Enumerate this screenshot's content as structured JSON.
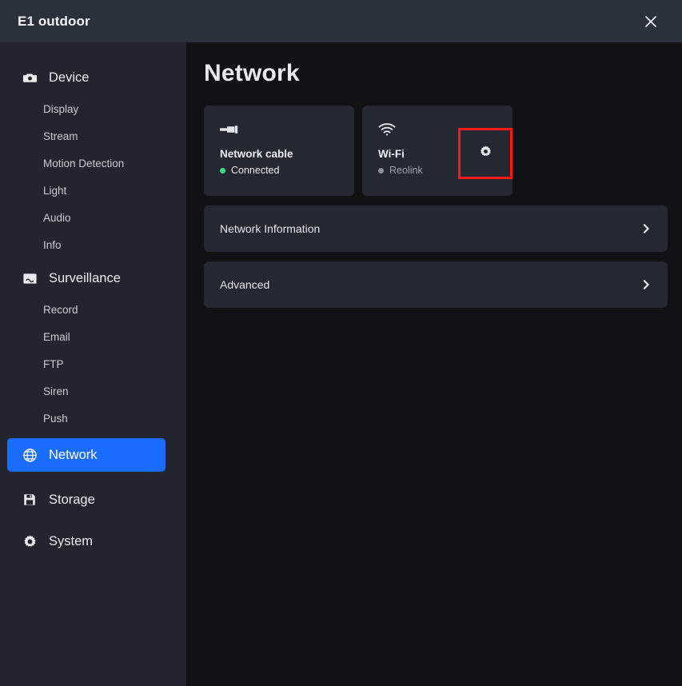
{
  "window": {
    "title": "E1 outdoor",
    "close_label": "×",
    "close_icon": "close-icon"
  },
  "colors": {
    "titlebar_bg": "#2b313b",
    "sidebar_bg": "#22252f",
    "main_bg": "#111216",
    "card_bg": "#242833",
    "accent_blue": "#1a6dff",
    "status_connected": "#3ddc84",
    "status_idle": "#8c9099",
    "highlight_red": "#ff1a10"
  },
  "sidebar": {
    "groups": [
      {
        "label": "Device",
        "icon": "camera-icon",
        "selected": false,
        "items": [
          {
            "label": "Display"
          },
          {
            "label": "Stream"
          },
          {
            "label": "Motion Detection"
          },
          {
            "label": "Light"
          },
          {
            "label": "Audio"
          },
          {
            "label": "Info"
          }
        ]
      },
      {
        "label": "Surveillance",
        "icon": "monitor-icon",
        "selected": false,
        "items": [
          {
            "label": "Record"
          },
          {
            "label": "Email"
          },
          {
            "label": "FTP"
          },
          {
            "label": "Siren"
          },
          {
            "label": "Push"
          }
        ]
      },
      {
        "label": "Network",
        "icon": "globe-icon",
        "selected": true,
        "items": []
      },
      {
        "label": "Storage",
        "icon": "floppy-disk-icon",
        "selected": false,
        "items": []
      },
      {
        "label": "System",
        "icon": "gear-icon",
        "selected": false,
        "items": []
      }
    ]
  },
  "main": {
    "page_title": "Network",
    "cards": [
      {
        "icon": "ethernet-plug-icon",
        "title": "Network cable",
        "status": "Connected",
        "status_color": "#3ddc84",
        "has_gear": false,
        "highlighted": false
      },
      {
        "icon": "wifi-icon",
        "title": "Wi-Fi",
        "status": "Reolink",
        "status_color": "#8c9099",
        "has_gear": true,
        "gear_icon": "gear-icon",
        "highlighted": true
      }
    ],
    "rows": [
      {
        "label": "Network Information",
        "chevron": "chevron-right-icon"
      },
      {
        "label": "Advanced",
        "chevron": "chevron-right-icon"
      }
    ]
  }
}
